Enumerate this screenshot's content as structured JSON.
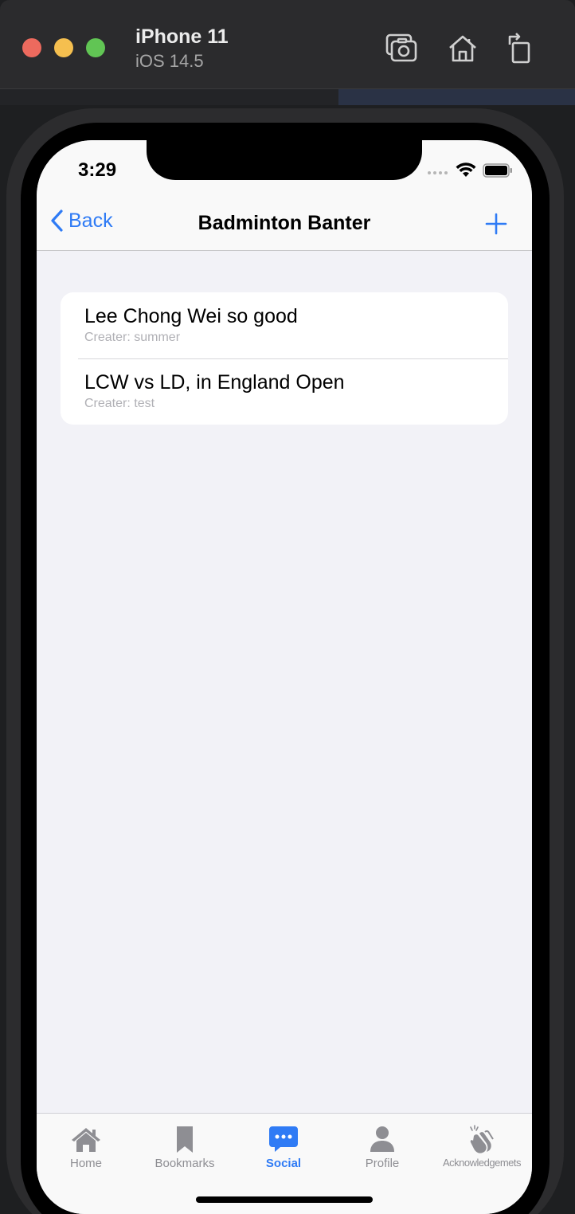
{
  "window": {
    "device_name": "iPhone 11",
    "os_version": "iOS 14.5",
    "toolbar_icons": [
      "screenshot-icon",
      "home-icon",
      "rotate-icon"
    ]
  },
  "status_bar": {
    "time": "3:29"
  },
  "nav": {
    "back_label": "Back",
    "title": "Badminton Banter",
    "add_icon": "plus-icon",
    "accent_color": "#2f7bf5"
  },
  "threads": [
    {
      "title": "Lee Chong Wei so good",
      "subtitle": "Creater: summer"
    },
    {
      "title": "LCW vs LD, in England Open",
      "subtitle": "Creater: test"
    }
  ],
  "tabbar": {
    "items": [
      {
        "label": "Home",
        "icon": "house-icon",
        "active": false
      },
      {
        "label": "Bookmarks",
        "icon": "bookmark-icon",
        "active": false
      },
      {
        "label": "Social",
        "icon": "chat-bubble-icon",
        "active": true
      },
      {
        "label": "Profile",
        "icon": "person-icon",
        "active": false
      },
      {
        "label": "Acknowledgemets",
        "icon": "clapping-hands-icon",
        "active": false
      }
    ]
  }
}
